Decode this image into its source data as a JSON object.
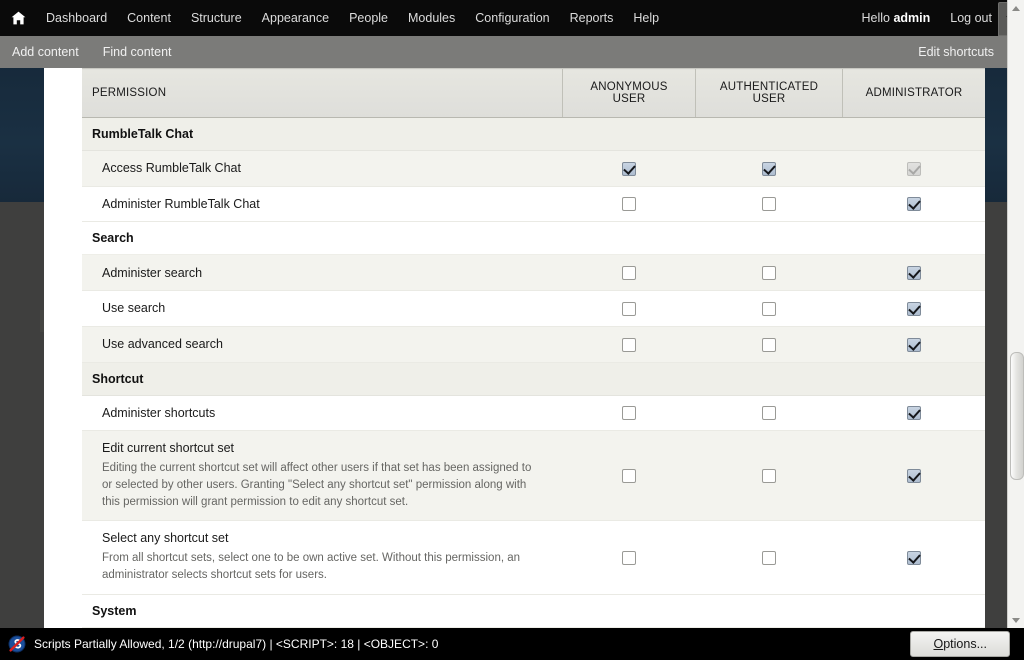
{
  "toolbar": {
    "home_icon": "home-icon",
    "items": [
      {
        "label": "Dashboard"
      },
      {
        "label": "Content"
      },
      {
        "label": "Structure"
      },
      {
        "label": "Appearance"
      },
      {
        "label": "People"
      },
      {
        "label": "Modules"
      },
      {
        "label": "Configuration"
      },
      {
        "label": "Reports"
      },
      {
        "label": "Help"
      }
    ],
    "greeting_prefix": "Hello ",
    "username": "admin",
    "logout_label": "Log out",
    "toggle_icon": "chevron-down-icon"
  },
  "shortcuts": {
    "items": [
      {
        "label": "Add content"
      },
      {
        "label": "Find content"
      }
    ],
    "edit_label": "Edit shortcuts"
  },
  "background": {
    "logout_label": "Log out"
  },
  "permissions_table": {
    "columns": {
      "permission": "PERMISSION",
      "anonymous_line1": "ANONYMOUS",
      "anonymous_line2": "USER",
      "authenticated_line1": "AUTHENTICATED",
      "authenticated_line2": "USER",
      "administrator": "ADMINISTRATOR"
    },
    "sections": [
      {
        "name": "RumbleTalk Chat",
        "rows": [
          {
            "title": "Access RumbleTalk Chat",
            "description": "",
            "anonymous": "checked",
            "authenticated": "checked",
            "administrator": "checked-disabled"
          },
          {
            "title": "Administer RumbleTalk Chat",
            "description": "",
            "anonymous": "unchecked",
            "authenticated": "unchecked",
            "administrator": "checked"
          }
        ]
      },
      {
        "name": "Search",
        "rows": [
          {
            "title": "Administer search",
            "description": "",
            "anonymous": "unchecked",
            "authenticated": "unchecked",
            "administrator": "checked"
          },
          {
            "title": "Use search",
            "description": "",
            "anonymous": "unchecked",
            "authenticated": "unchecked",
            "administrator": "checked"
          },
          {
            "title": "Use advanced search",
            "description": "",
            "anonymous": "unchecked",
            "authenticated": "unchecked",
            "administrator": "checked"
          }
        ]
      },
      {
        "name": "Shortcut",
        "rows": [
          {
            "title": "Administer shortcuts",
            "description": "",
            "anonymous": "unchecked",
            "authenticated": "unchecked",
            "administrator": "checked"
          },
          {
            "title": "Edit current shortcut set",
            "description": "Editing the current shortcut set will affect other users if that set has been assigned to or selected by other users. Granting \"Select any shortcut set\" permission along with this permission will grant permission to edit any shortcut set.",
            "anonymous": "unchecked",
            "authenticated": "unchecked",
            "administrator": "checked"
          },
          {
            "title": "Select any shortcut set",
            "description": "From all shortcut sets, select one to be own active set. Without this permission, an administrator selects shortcut sets for users.",
            "anonymous": "unchecked",
            "authenticated": "unchecked",
            "administrator": "checked"
          }
        ]
      },
      {
        "name": "System",
        "rows": []
      }
    ]
  },
  "statusbar": {
    "icon": "noscript-icon",
    "text": "Scripts Partially Allowed, 1/2 (http://drupal7) | <SCRIPT>: 18 | <OBJECT>: 0",
    "options_accel": "O",
    "options_rest": "ptions..."
  },
  "colors": {
    "toolbar_bg": "#0a0a0a",
    "shortcut_bg": "#7b7b79",
    "page_bg": "#3f3f3e",
    "navy_band": "#1b2e3f",
    "checkbox_checked": "#aebdd0"
  }
}
